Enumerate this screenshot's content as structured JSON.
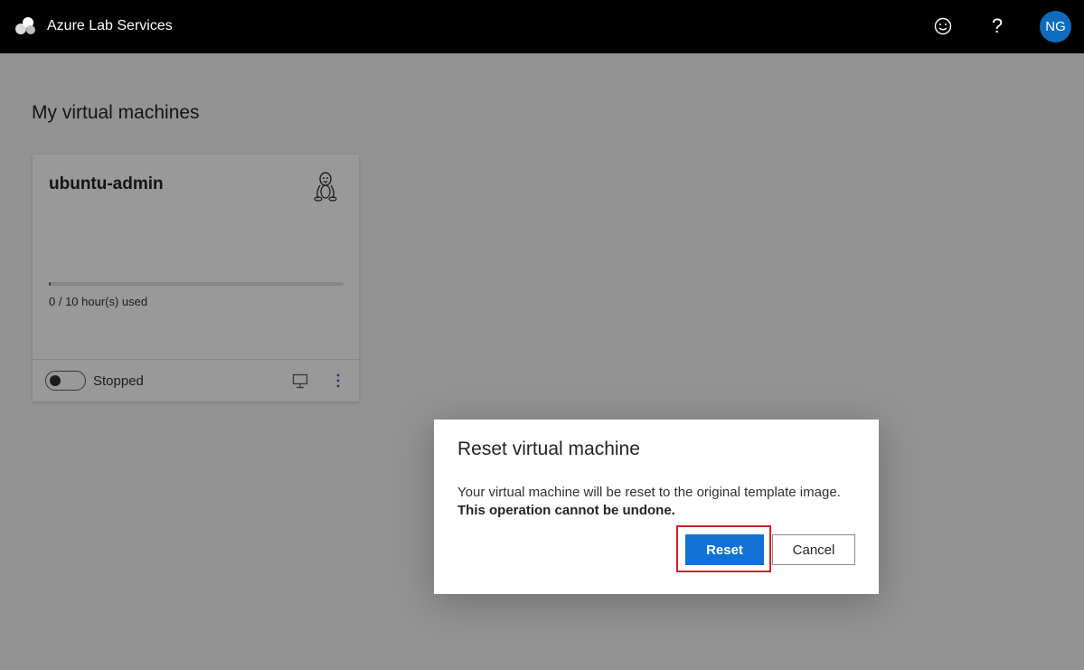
{
  "header": {
    "app_title": "Azure Lab Services",
    "logo_icon": "azure-lab-services-logo",
    "feedback_icon": "smiley-feedback-icon",
    "help_label": "?",
    "avatar_initials": "NG",
    "colors": {
      "bar": "#000000",
      "avatar": "#0f6cbd"
    }
  },
  "main": {
    "page_title": "My virtual machines",
    "vm_card": {
      "name": "ubuntu-admin",
      "os_icon": "linux-tux-icon",
      "usage_label": "0 / 10 hour(s) used",
      "usage_fraction": 0,
      "status_label": "Stopped",
      "connect_icon": "monitor-connect-icon",
      "more_icon": "more-vertical-icon"
    }
  },
  "dialog": {
    "title": "Reset virtual machine",
    "message": "Your virtual machine will be reset to the original template image.",
    "warning": "This operation cannot be undone.",
    "confirm_label": "Reset",
    "cancel_label": "Cancel",
    "colors": {
      "primary": "#0f72d4",
      "highlight": "#d11d27"
    }
  }
}
